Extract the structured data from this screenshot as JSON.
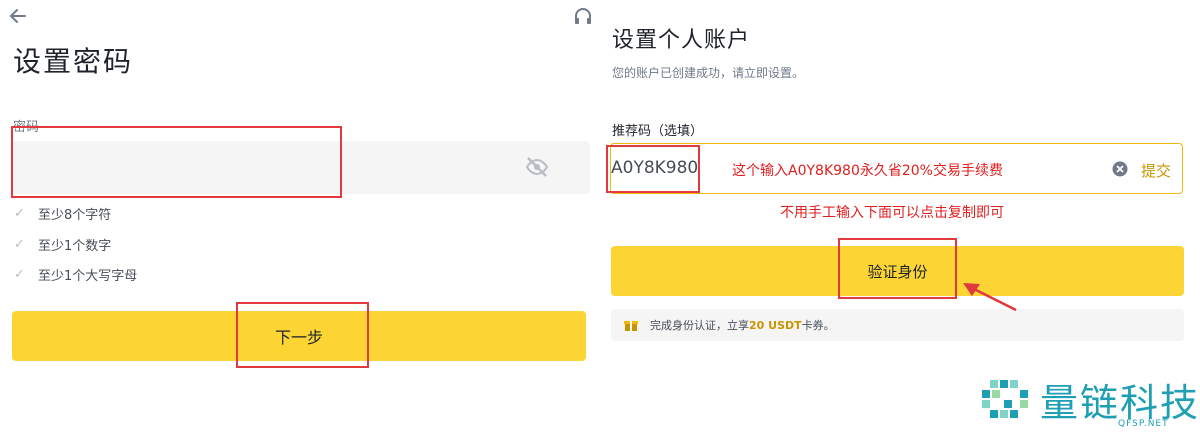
{
  "left": {
    "title": "设置密码",
    "password_label": "密码",
    "password_value": "",
    "requirements": [
      "至少8个字符",
      "至少1个数字",
      "至少1个大写字母"
    ],
    "next_label": "下一步"
  },
  "right": {
    "title": "设置个人账户",
    "subtitle": "您的账户已创建成功，请立即设置。",
    "referral_label": "推荐码（选填）",
    "referral_code": "A0Y8K980",
    "referral_note": "这个输入A0Y8K980永久省20%交易手续费",
    "submit_label": "提交",
    "red_hint": "不用手工输入下面可以点击复制即可",
    "verify_label": "验证身份",
    "reward_prefix": "完成身份认证，立享",
    "reward_amount": "20 USDT",
    "reward_suffix": "卡券。"
  },
  "watermark": {
    "name": "量链科技",
    "domain": "QFSP.NET"
  },
  "icons": {
    "back": "arrow-left-icon",
    "support": "headset-icon",
    "visibility": "eye-off-icon",
    "check": "check-icon",
    "clear": "clear-circle-icon",
    "gift": "gift-icon"
  },
  "colors": {
    "primary_yellow": "#fcd535",
    "accent_gold": "#c99400",
    "border_gold": "#f0b90b",
    "annotation_red": "#e0393e",
    "watermark_teal": "#1f9fb4"
  }
}
